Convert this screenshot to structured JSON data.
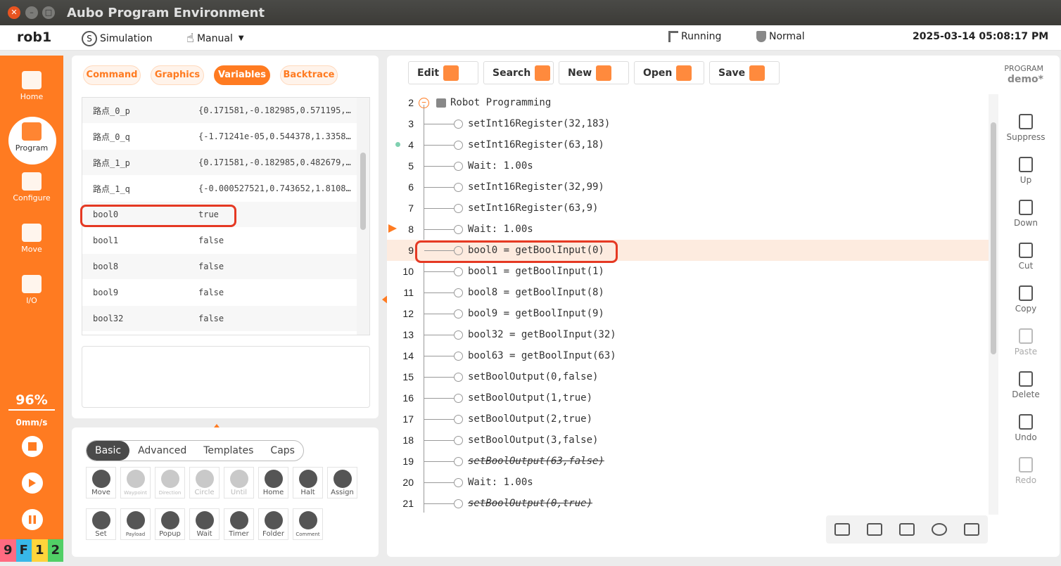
{
  "window": {
    "title": "Aubo Program Environment"
  },
  "topbar": {
    "robot": "rob1",
    "simulation": "Simulation",
    "mode": "Manual",
    "status": "Running",
    "safety": "Normal",
    "datetime": "2025-03-14 05:08:17 PM"
  },
  "sidebar": {
    "items": [
      {
        "label": "Home"
      },
      {
        "label": "Program"
      },
      {
        "label": "Configure"
      },
      {
        "label": "Move"
      },
      {
        "label": "I/O"
      }
    ],
    "speed": "96%",
    "velocity": "0mm/s",
    "fkeys": [
      "9",
      "F",
      "1",
      "2"
    ],
    "fkey_colors": [
      "#ff6b81",
      "#38b8e8",
      "#ffd43b",
      "#51cf66"
    ]
  },
  "left_tabs": [
    "Command",
    "Graphics",
    "Variables",
    "Backtrace"
  ],
  "variables": [
    {
      "name": "路点_0_p",
      "value": "{0.171581,-0.182985,0.571195,…"
    },
    {
      "name": "路点_0_q",
      "value": "{-1.71241e-05,0.544378,1.3358…"
    },
    {
      "name": "路点_1_p",
      "value": "{0.171581,-0.182985,0.482679,…"
    },
    {
      "name": "路点_1_q",
      "value": "{-0.000527521,0.743652,1.8108…"
    },
    {
      "name": "bool0",
      "value": "true"
    },
    {
      "name": "bool1",
      "value": "false"
    },
    {
      "name": "bool8",
      "value": "false"
    },
    {
      "name": "bool9",
      "value": "false"
    },
    {
      "name": "bool32",
      "value": "false"
    }
  ],
  "block_tabs": [
    "Basic",
    "Advanced",
    "Templates",
    "Caps"
  ],
  "blocks_row1": [
    {
      "label": "Move",
      "small": false,
      "disabled": false
    },
    {
      "label": "Waypoint",
      "small": true,
      "disabled": true
    },
    {
      "label": "Direction",
      "small": true,
      "disabled": true
    },
    {
      "label": "Circle",
      "small": false,
      "disabled": true
    },
    {
      "label": "Until",
      "small": false,
      "disabled": true
    },
    {
      "label": "Home",
      "small": false,
      "disabled": false
    },
    {
      "label": "Halt",
      "small": false,
      "disabled": false
    },
    {
      "label": "Assign",
      "small": false,
      "disabled": false
    }
  ],
  "blocks_row2": [
    {
      "label": "Set",
      "small": false,
      "disabled": false
    },
    {
      "label": "Payload",
      "small": true,
      "disabled": false
    },
    {
      "label": "Popup",
      "small": false,
      "disabled": false
    },
    {
      "label": "Wait",
      "small": false,
      "disabled": false
    },
    {
      "label": "Timer",
      "small": false,
      "disabled": false
    },
    {
      "label": "Folder",
      "small": false,
      "disabled": false
    },
    {
      "label": "Comment",
      "small": true,
      "disabled": false
    }
  ],
  "toolbar": {
    "edit": "Edit",
    "search": "Search",
    "new": "New",
    "open": "Open",
    "save": "Save"
  },
  "program": {
    "label": "PROGRAM",
    "name": "demo*"
  },
  "code_lines": [
    {
      "num": "2",
      "text": "Robot Programming",
      "root": true
    },
    {
      "num": "3",
      "text": "setInt16Register(32,183)"
    },
    {
      "num": "4",
      "text": "setInt16Register(63,18)"
    },
    {
      "num": "5",
      "text": "Wait: 1.00s"
    },
    {
      "num": "6",
      "text": "setInt16Register(32,99)"
    },
    {
      "num": "7",
      "text": "setInt16Register(63,9)"
    },
    {
      "num": "8",
      "text": "Wait: 1.00s"
    },
    {
      "num": "9",
      "text": "bool0 = getBoolInput(0)",
      "highlight": true
    },
    {
      "num": "10",
      "text": "bool1 = getBoolInput(1)"
    },
    {
      "num": "11",
      "text": "bool8 = getBoolInput(8)"
    },
    {
      "num": "12",
      "text": "bool9 = getBoolInput(9)"
    },
    {
      "num": "13",
      "text": "bool32 = getBoolInput(32)"
    },
    {
      "num": "14",
      "text": "bool63 = getBoolInput(63)"
    },
    {
      "num": "15",
      "text": "setBoolOutput(0,false)"
    },
    {
      "num": "16",
      "text": "setBoolOutput(1,true)"
    },
    {
      "num": "17",
      "text": "setBoolOutput(2,true)"
    },
    {
      "num": "18",
      "text": "setBoolOutput(3,false)"
    },
    {
      "num": "19",
      "text": "setBoolOutput(63,false)",
      "suppressed": true
    },
    {
      "num": "20",
      "text": "Wait: 1.00s"
    },
    {
      "num": "21",
      "text": "setBoolOutput(0,true)",
      "suppressed": true
    }
  ],
  "right_tools": [
    {
      "label": "Suppress",
      "disabled": false
    },
    {
      "label": "Up",
      "disabled": false
    },
    {
      "label": "Down",
      "disabled": false
    },
    {
      "label": "Cut",
      "disabled": false
    },
    {
      "label": "Copy",
      "disabled": false
    },
    {
      "label": "Paste",
      "disabled": true
    },
    {
      "label": "Delete",
      "disabled": false
    },
    {
      "label": "Undo",
      "disabled": false
    },
    {
      "label": "Redo",
      "disabled": true
    }
  ],
  "colors": {
    "accent": "#ff7b21",
    "highlight_box": "#e53923",
    "line_highlight": "#fdebdf"
  }
}
